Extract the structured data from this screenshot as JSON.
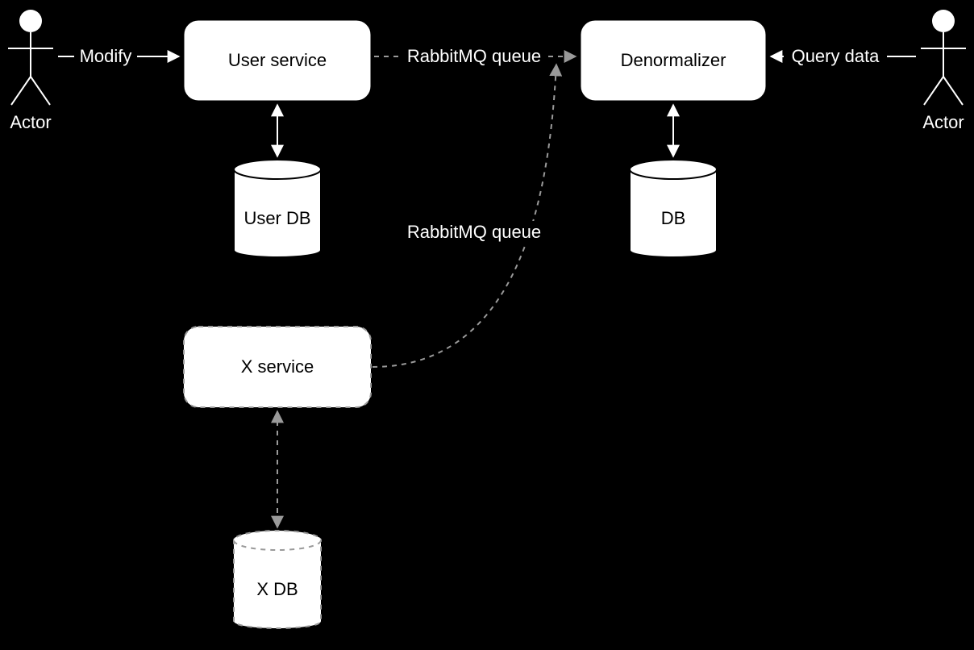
{
  "actors": {
    "left": {
      "label": "Actor"
    },
    "right": {
      "label": "Actor"
    }
  },
  "nodes": {
    "user_service": {
      "label": "User service"
    },
    "denormalizer": {
      "label": "Denormalizer"
    },
    "x_service": {
      "label": "X service"
    },
    "user_db": {
      "label": "User DB"
    },
    "db": {
      "label": "DB"
    },
    "x_db": {
      "label": "X DB"
    }
  },
  "edges": {
    "modify": {
      "label": "Modify"
    },
    "queue1": {
      "label": "RabbitMQ queue"
    },
    "query": {
      "label": "Query data"
    },
    "queue2": {
      "label": "RabbitMQ queue"
    }
  }
}
